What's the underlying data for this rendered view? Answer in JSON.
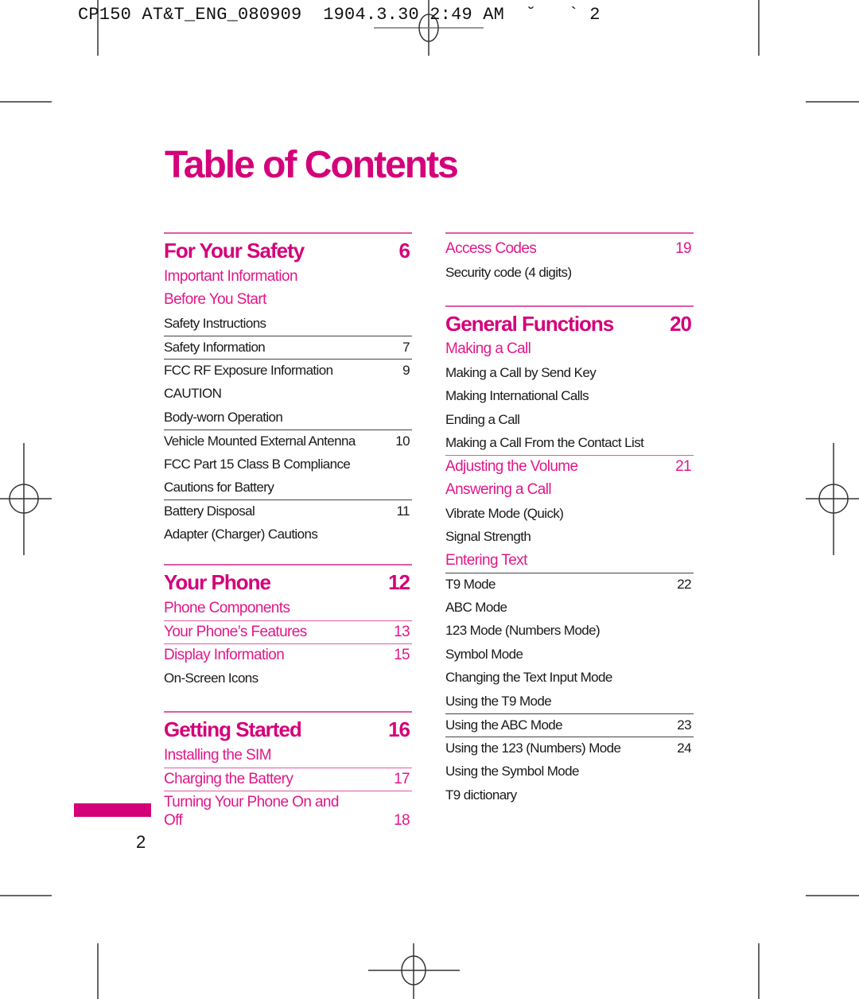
{
  "slug": "CP150 AT&T_ENG_080909  1904.3.30 2:49 AM  ˘   ` 2",
  "title": "Table of Contents",
  "page_number": "2",
  "colors": {
    "accent": "#d4007a",
    "subhead": "#e0188a",
    "rule_pink": "#e05aa8",
    "text": "#1a1a1a"
  },
  "left_column": {
    "safety": {
      "title": "For Your Safety",
      "page": "6",
      "entries": [
        {
          "label": "Important Information",
          "page": ""
        },
        {
          "label": "Before You Start",
          "page": ""
        },
        {
          "label": "Safety Instructions",
          "page": ""
        },
        {
          "label": "Safety Information",
          "page": "7"
        },
        {
          "label": "FCC RF Exposure Information",
          "page": "9"
        },
        {
          "label": "CAUTION",
          "page": ""
        },
        {
          "label": "Body-worn Operation",
          "page": ""
        },
        {
          "label": "Vehicle Mounted External Antenna",
          "page": "10"
        },
        {
          "label": "FCC Part 15 Class B Compliance",
          "page": ""
        },
        {
          "label": "Cautions for Battery",
          "page": ""
        },
        {
          "label": "Battery Disposal",
          "page": "11"
        },
        {
          "label": "Adapter (Charger) Cautions",
          "page": ""
        }
      ]
    },
    "your_phone": {
      "title": "Your Phone",
      "page": "12",
      "entries": [
        {
          "label": "Phone Components",
          "page": ""
        },
        {
          "label": "Your Phone’s Features",
          "page": "13"
        },
        {
          "label": "Display Information",
          "page": "15"
        },
        {
          "label": "On-Screen Icons",
          "page": ""
        }
      ]
    },
    "getting_started": {
      "title": "Getting Started",
      "page": "16",
      "entries": [
        {
          "label": "Installing the SIM",
          "page": ""
        },
        {
          "label": "Charging the Battery",
          "page": "17"
        },
        {
          "label": "Turning Your Phone On and Off",
          "page": "18"
        }
      ]
    }
  },
  "right_column": {
    "access": {
      "entries": [
        {
          "label": "Access Codes",
          "page": "19"
        },
        {
          "label": "Security code (4 digits)",
          "page": ""
        }
      ]
    },
    "general": {
      "title": "General Functions",
      "page": "20",
      "entries": [
        {
          "label": "Making a Call",
          "page": ""
        },
        {
          "label": "Making a Call by Send Key",
          "page": ""
        },
        {
          "label": "Making International Calls",
          "page": ""
        },
        {
          "label": "Ending a Call",
          "page": ""
        },
        {
          "label": "Making a Call From the Contact List",
          "page": ""
        },
        {
          "label": "Adjusting the Volume",
          "page": "21"
        },
        {
          "label": "Answering a Call",
          "page": ""
        },
        {
          "label": "Vibrate Mode (Quick)",
          "page": ""
        },
        {
          "label": "Signal Strength",
          "page": ""
        },
        {
          "label": "Entering Text",
          "page": ""
        },
        {
          "label": "T9 Mode",
          "page": "22"
        },
        {
          "label": "ABC Mode",
          "page": ""
        },
        {
          "label": "123 Mode (Numbers Mode)",
          "page": ""
        },
        {
          "label": "Symbol Mode",
          "page": ""
        },
        {
          "label": "Changing the Text Input Mode",
          "page": ""
        },
        {
          "label": "Using the T9 Mode",
          "page": ""
        },
        {
          "label": "Using the ABC Mode",
          "page": "23"
        },
        {
          "label": "Using the 123 (Numbers) Mode",
          "page": "24"
        },
        {
          "label": "Using the Symbol Mode",
          "page": ""
        },
        {
          "label": "T9 dictionary",
          "page": ""
        }
      ]
    }
  }
}
